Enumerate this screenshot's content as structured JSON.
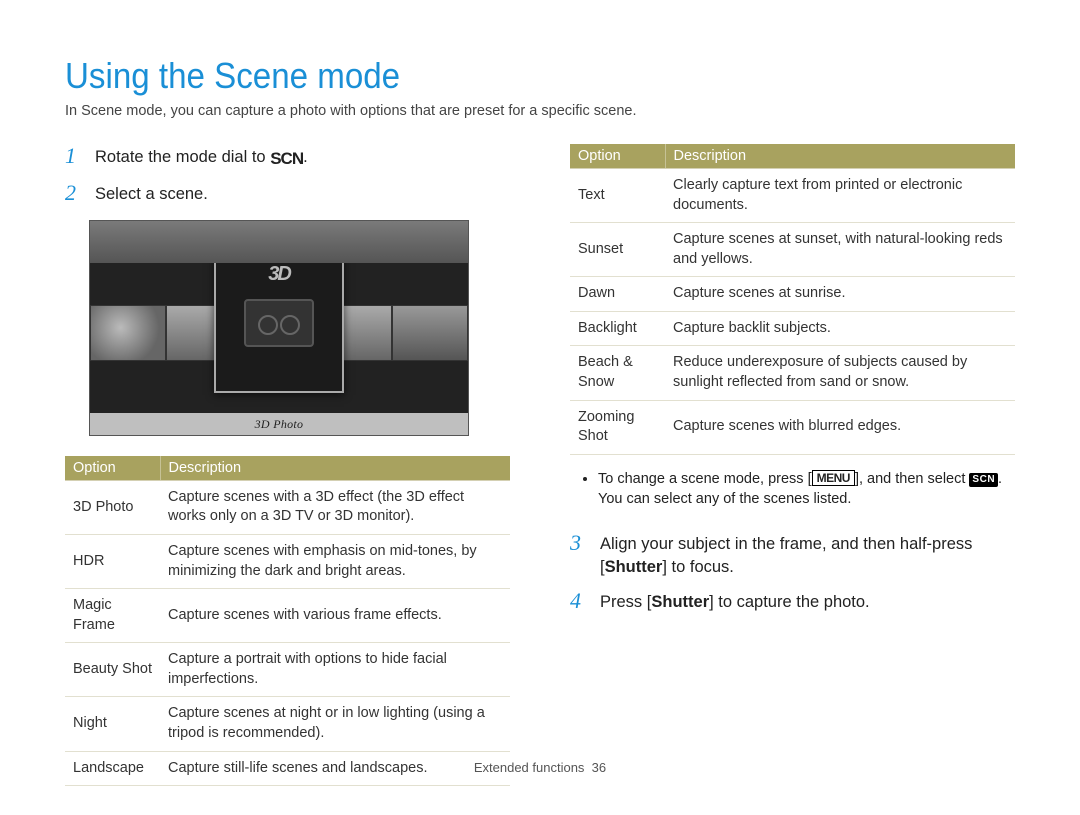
{
  "title": "Using the Scene mode",
  "intro": "In Scene mode, you can capture a photo with options that are preset for a specific scene.",
  "steps": {
    "s1": {
      "num": "1",
      "pre": "Rotate the mode dial to ",
      "scn": "SCN",
      "post": "."
    },
    "s2": {
      "num": "2",
      "text": "Select a scene."
    },
    "s3": {
      "num": "3",
      "pre": "Align your subject in the frame, and then half-press [",
      "bold": "Shutter",
      "post": "] to focus."
    },
    "s4": {
      "num": "4",
      "pre": "Press [",
      "bold": "Shutter",
      "post": "] to capture the photo."
    }
  },
  "screenshot": {
    "icon3d": "3D",
    "label": "3D Photo"
  },
  "table_headers": {
    "option": "Option",
    "description": "Description"
  },
  "table_left": [
    {
      "opt": "3D Photo",
      "desc": "Capture scenes with a 3D effect (the 3D effect works only on a 3D TV or 3D monitor)."
    },
    {
      "opt": "HDR",
      "desc": "Capture scenes with emphasis on mid-tones, by minimizing the dark and bright areas."
    },
    {
      "opt": "Magic Frame",
      "desc": "Capture scenes with various frame effects."
    },
    {
      "opt": "Beauty Shot",
      "desc": "Capture a portrait with options to hide facial imperfections."
    },
    {
      "opt": "Night",
      "desc": "Capture scenes at night or in low lighting (using a tripod is recommended)."
    },
    {
      "opt": "Landscape",
      "desc": "Capture still-life scenes and landscapes."
    }
  ],
  "table_right": [
    {
      "opt": "Text",
      "desc": "Clearly capture text from printed or electronic documents."
    },
    {
      "opt": "Sunset",
      "desc": "Capture scenes at sunset, with natural-looking reds and yellows."
    },
    {
      "opt": "Dawn",
      "desc": "Capture scenes at sunrise."
    },
    {
      "opt": "Backlight",
      "desc": "Capture backlit subjects."
    },
    {
      "opt": "Beach & Snow",
      "desc": "Reduce underexposure of subjects caused by sunlight reflected from sand or snow."
    },
    {
      "opt": "Zooming Shot",
      "desc": "Capture scenes with blurred edges."
    }
  ],
  "note": {
    "pre": "To change a scene mode, press [",
    "menu": "MENU",
    "mid": "], and then select ",
    "m": "SCN",
    "post": ". You can select any of the scenes listed."
  },
  "footer": {
    "section": "Extended functions",
    "page": "36"
  }
}
